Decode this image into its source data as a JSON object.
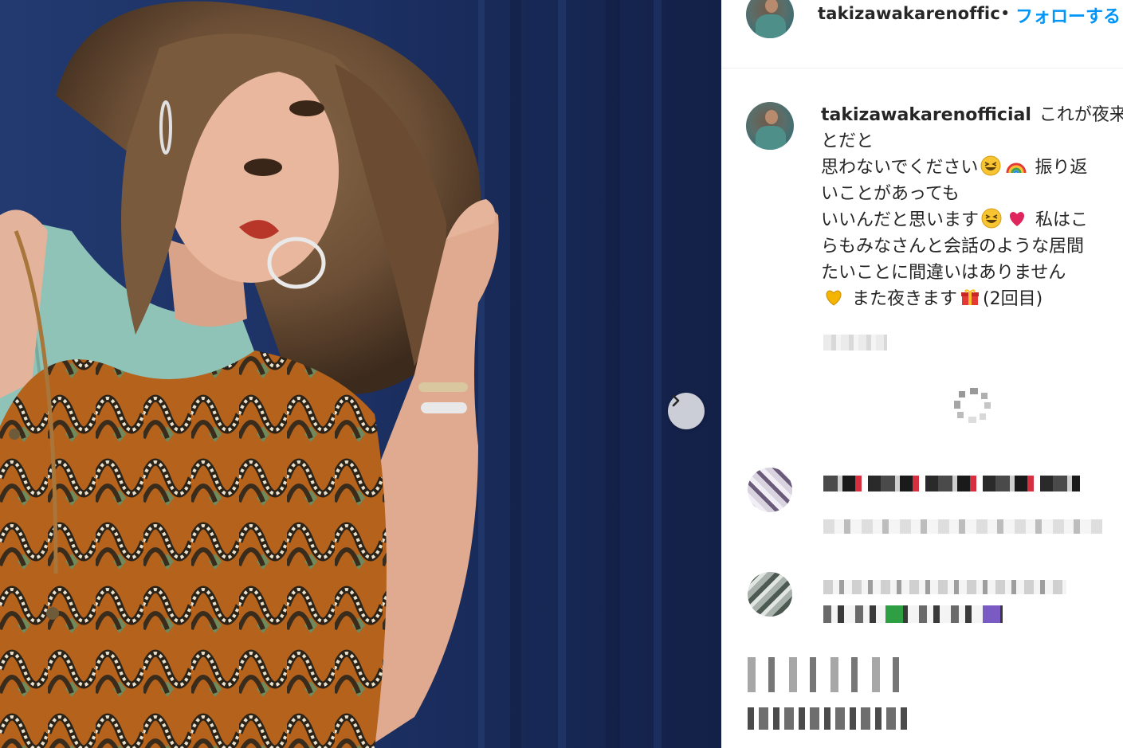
{
  "post": {
    "header": {
      "username": "takizawakarenoffic",
      "separator": "•",
      "follow_label": "フォローする"
    },
    "caption": {
      "username": "takizawakarenofficial",
      "lines": [
        "これが夜来",
        "とだと",
        "思わないでください",
        "振り返",
        "いことがあっても",
        "いいんだと思います",
        "私はこ",
        "らもみなさんと会話のような居間",
        "たいことに間違いはありません",
        "また夜きます",
        "(2回目)"
      ]
    },
    "emojis": [
      "grinning-squinting-face-icon",
      "rainbow-icon",
      "grinning-squinting-face-icon",
      "sparkling-heart-icon",
      "yellow-heart-icon",
      "gift-icon"
    ],
    "carousel": {
      "next_icon": "chevron-right-icon"
    },
    "colors": {
      "follow": "#0095f6",
      "text": "#262626",
      "backdrop": "#1f3266"
    }
  }
}
